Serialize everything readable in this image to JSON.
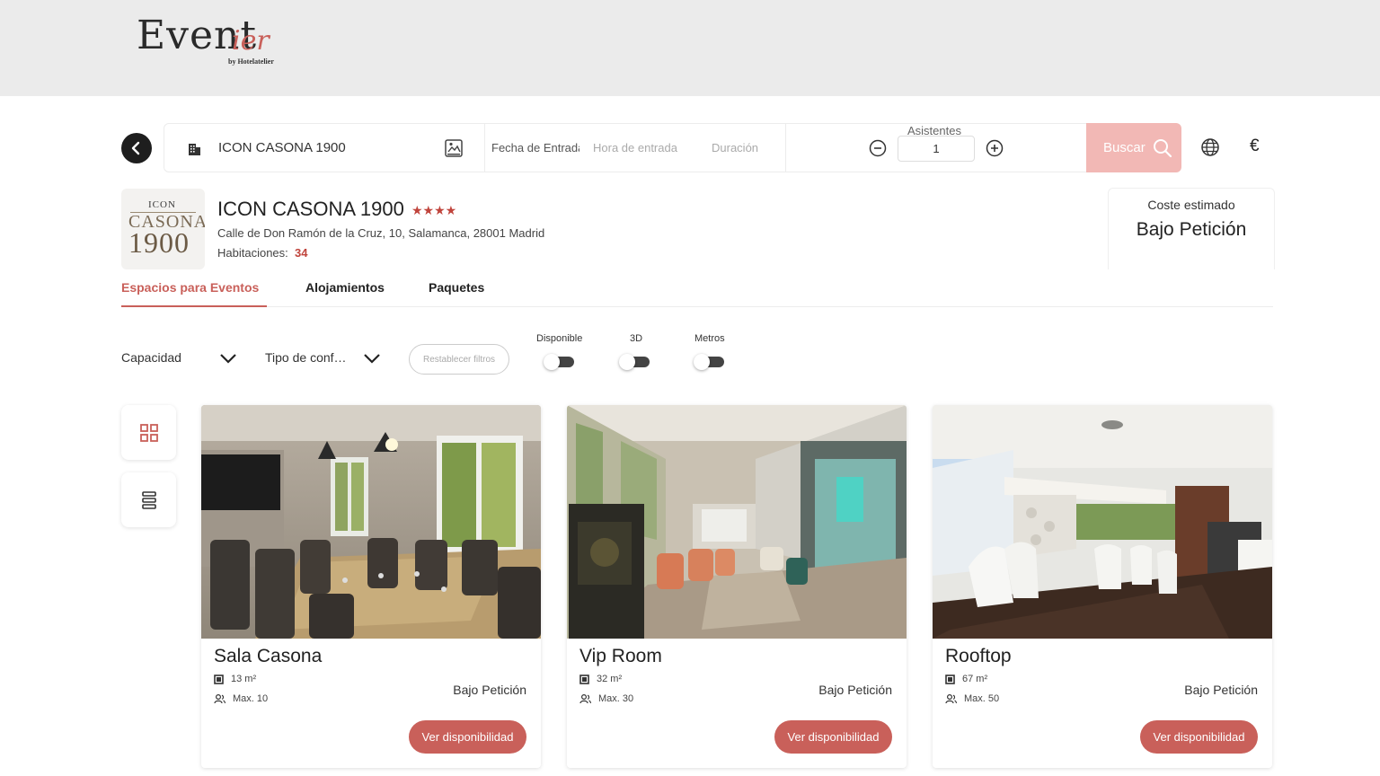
{
  "brand": {
    "logo_main": "Event",
    "logo_script": "ier",
    "logo_by": "by Hotelatelier"
  },
  "search": {
    "hotel": "ICON CASONA 1900",
    "fecha_placeholder": "Fecha de Entrada",
    "hora_placeholder": "Hora de entrada",
    "duracion_placeholder": "Duración",
    "asistentes_label": "Asistentes",
    "asistentes_value": "1",
    "buscar_label": "Buscar",
    "currency": "€"
  },
  "hotel": {
    "logo_icon": "ICON",
    "logo_casona": "CASONA",
    "logo_year": "1900",
    "name": "ICON CASONA 1900",
    "stars": "★★★★",
    "address": "Calle de Don Ramón de la Cruz, 10, Salamanca, 28001 Madrid",
    "rooms_label": "Habitaciones:",
    "rooms_value": "34"
  },
  "cost": {
    "label": "Coste estimado",
    "value": "Bajo Petición"
  },
  "tabs": [
    {
      "label": "Espacios para Eventos",
      "active": true
    },
    {
      "label": "Alojamientos",
      "active": false
    },
    {
      "label": "Paquetes",
      "active": false
    }
  ],
  "filters": {
    "capacidad": "Capacidad",
    "tipo": "Tipo de conf…",
    "reset": "Restablecer filtros",
    "toggles": [
      {
        "label": "Disponible",
        "on": false
      },
      {
        "label": "3D",
        "on": false
      },
      {
        "label": "Metros",
        "on": false
      }
    ]
  },
  "icons": {
    "back": "arrow-left-icon",
    "building": "building-icon",
    "map": "map-icon",
    "minus": "minus-circle-icon",
    "plus": "plus-circle-icon",
    "search": "search-icon",
    "globe": "globe-icon",
    "grid": "grid-view-icon",
    "list": "list-view-icon",
    "area": "area-icon",
    "people": "people-icon",
    "chevron": "chevron-down-icon"
  },
  "colors": {
    "accent": "#c9605a",
    "search_button": "#f2b8b5",
    "header_bg": "#ebebeb"
  },
  "spaces": [
    {
      "name": "Sala Casona",
      "area": "13 m²",
      "max": "Max. 10",
      "price": "Bajo Petición",
      "cta": "Ver disponibilidad"
    },
    {
      "name": "Vip Room",
      "area": "32 m²",
      "max": "Max. 30",
      "price": "Bajo Petición",
      "cta": "Ver disponibilidad"
    },
    {
      "name": "Rooftop",
      "area": "67 m²",
      "max": "Max. 50",
      "price": "Bajo Petición",
      "cta": "Ver disponibilidad"
    }
  ]
}
